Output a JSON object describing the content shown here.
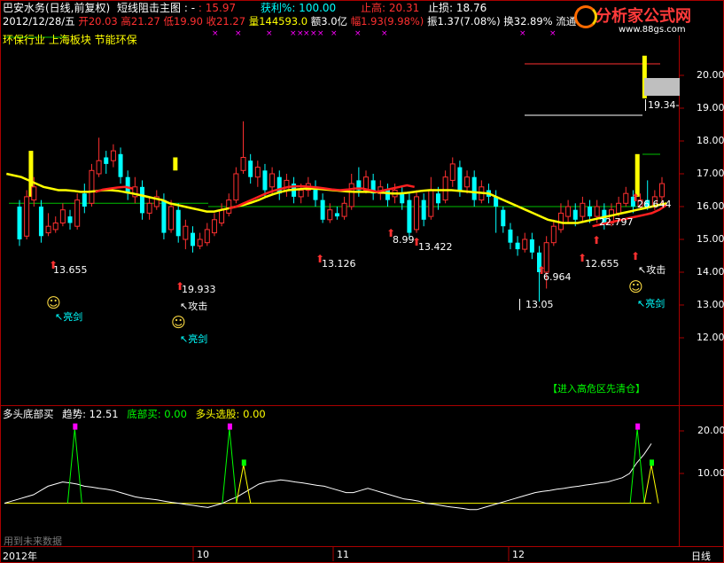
{
  "header": {
    "stock_title": "巴安水务(日线,前复权)",
    "indicator_name": "短线阻击主图",
    "indicator_sep": ": -",
    "indicator_value": ": 15.97",
    "profit_label": "获利%: 100.00",
    "stop_high": "止高: 20.31",
    "stop_loss": "止损: 18.76",
    "date_line": "2012/12/28/五",
    "open": "开20.03",
    "high": "高21.27",
    "low": "低19.90",
    "close": "收21.27",
    "volume": "量144593.0",
    "amount": "额3.0亿",
    "range": "幅1.93(9.98%)",
    "amplitude": "振1.37(7.08%)",
    "turnover": "换32.89%",
    "float_label": "流通",
    "industry": "环保行业 上海板块 节能环保"
  },
  "logo": {
    "name": "分析家公式网",
    "url": "www.88gs.com"
  },
  "price_axis": {
    "ticks": [
      "20.00",
      "19.00",
      "18.00",
      "17.00",
      "16.00",
      "15.00",
      "14.00",
      "13.00",
      "12.00"
    ],
    "current_marker": "19.34-"
  },
  "annotations": {
    "values": [
      "13.655",
      "19.933",
      "13.126",
      "8.99",
      "13.422",
      "6.964",
      "12.655",
      "22.797",
      "26.644",
      "13.05"
    ],
    "labels": {
      "liangjian": "亮剑",
      "gongji": "攻击"
    },
    "warning": "【进入高危区先清仓】"
  },
  "lower_panel": {
    "title": "多头底部买",
    "trend": "趋势: 12.51",
    "bottom_buy": "底部买: 0.00",
    "select": "多头选股: 0.00",
    "ticks": [
      "20.00",
      "10.00"
    ],
    "watermark": "用到未来数据"
  },
  "time_axis": {
    "labels": [
      "2012年",
      "10",
      "11",
      "12"
    ],
    "period": "日线"
  },
  "colors": {
    "up": "#ff3030",
    "down": "#00ffff",
    "ma_yellow": "#ffff00",
    "ma_red": "#ff2020",
    "grid_red": "#aa0000",
    "green_line": "#00c000",
    "magenta": "#ff00ff"
  },
  "chart_data": {
    "type": "candlestick",
    "y_range": [
      12.0,
      20.5
    ],
    "candles": [
      {
        "o": 16.0,
        "c": 15.0,
        "h": 16.2,
        "l": 14.8
      },
      {
        "o": 15.1,
        "c": 16.3,
        "h": 16.5,
        "l": 15.0
      },
      {
        "o": 16.2,
        "c": 16.6,
        "h": 16.9,
        "l": 16.0
      },
      {
        "o": 16.0,
        "c": 15.1,
        "h": 16.2,
        "l": 14.9
      },
      {
        "o": 15.2,
        "c": 15.4,
        "h": 15.8,
        "l": 15.1
      },
      {
        "o": 15.3,
        "c": 15.5,
        "h": 15.7,
        "l": 15.2
      },
      {
        "o": 15.5,
        "c": 15.9,
        "h": 16.1,
        "l": 15.4
      },
      {
        "o": 15.7,
        "c": 15.5,
        "h": 15.9,
        "l": 15.3
      },
      {
        "o": 15.4,
        "c": 16.2,
        "h": 16.4,
        "l": 15.3
      },
      {
        "o": 16.4,
        "c": 16.0,
        "h": 16.7,
        "l": 15.8
      },
      {
        "o": 16.1,
        "c": 17.1,
        "h": 17.3,
        "l": 16.0
      },
      {
        "o": 17.0,
        "c": 17.4,
        "h": 18.1,
        "l": 16.9
      },
      {
        "o": 17.5,
        "c": 17.3,
        "h": 17.7,
        "l": 17.0
      },
      {
        "o": 17.4,
        "c": 17.7,
        "h": 17.9,
        "l": 17.2
      },
      {
        "o": 17.6,
        "c": 16.9,
        "h": 17.8,
        "l": 16.7
      },
      {
        "o": 16.9,
        "c": 16.4,
        "h": 17.1,
        "l": 16.2
      },
      {
        "o": 16.3,
        "c": 16.6,
        "h": 16.9,
        "l": 16.1
      },
      {
        "o": 16.6,
        "c": 15.8,
        "h": 16.8,
        "l": 15.6
      },
      {
        "o": 15.8,
        "c": 16.1,
        "h": 16.3,
        "l": 15.6
      },
      {
        "o": 16.0,
        "c": 16.3,
        "h": 16.5,
        "l": 15.9
      },
      {
        "o": 16.2,
        "c": 15.2,
        "h": 16.4,
        "l": 15.0
      },
      {
        "o": 15.3,
        "c": 16.0,
        "h": 16.2,
        "l": 15.2
      },
      {
        "o": 15.9,
        "c": 15.1,
        "h": 16.1,
        "l": 14.9
      },
      {
        "o": 15.0,
        "c": 15.4,
        "h": 15.6,
        "l": 14.7
      },
      {
        "o": 15.2,
        "c": 14.8,
        "h": 15.4,
        "l": 14.6
      },
      {
        "o": 14.8,
        "c": 15.0,
        "h": 15.2,
        "l": 14.7
      },
      {
        "o": 14.9,
        "c": 15.3,
        "h": 15.5,
        "l": 14.8
      },
      {
        "o": 15.2,
        "c": 15.6,
        "h": 15.8,
        "l": 15.1
      },
      {
        "o": 15.5,
        "c": 15.9,
        "h": 16.1,
        "l": 15.4
      },
      {
        "o": 15.8,
        "c": 16.2,
        "h": 16.4,
        "l": 15.7
      },
      {
        "o": 16.2,
        "c": 17.0,
        "h": 17.2,
        "l": 16.1
      },
      {
        "o": 17.1,
        "c": 17.5,
        "h": 18.6,
        "l": 17.0
      },
      {
        "o": 17.4,
        "c": 16.9,
        "h": 17.6,
        "l": 16.7
      },
      {
        "o": 16.9,
        "c": 17.2,
        "h": 17.4,
        "l": 16.6
      },
      {
        "o": 17.1,
        "c": 16.5,
        "h": 17.3,
        "l": 16.3
      },
      {
        "o": 16.6,
        "c": 17.0,
        "h": 17.2,
        "l": 16.4
      },
      {
        "o": 16.9,
        "c": 16.4,
        "h": 17.1,
        "l": 16.2
      },
      {
        "o": 16.5,
        "c": 16.8,
        "h": 17.0,
        "l": 16.3
      },
      {
        "o": 16.7,
        "c": 16.3,
        "h": 16.9,
        "l": 16.1
      },
      {
        "o": 16.3,
        "c": 16.5,
        "h": 16.7,
        "l": 16.1
      },
      {
        "o": 16.5,
        "c": 16.7,
        "h": 16.9,
        "l": 16.3
      },
      {
        "o": 16.6,
        "c": 16.2,
        "h": 16.8,
        "l": 16.0
      },
      {
        "o": 16.2,
        "c": 15.6,
        "h": 16.4,
        "l": 15.5
      },
      {
        "o": 15.6,
        "c": 15.9,
        "h": 16.1,
        "l": 15.5
      },
      {
        "o": 15.8,
        "c": 15.7,
        "h": 16.0,
        "l": 15.6
      },
      {
        "o": 15.7,
        "c": 16.1,
        "h": 16.3,
        "l": 15.6
      },
      {
        "o": 16.0,
        "c": 16.7,
        "h": 17.0,
        "l": 15.9
      },
      {
        "o": 16.8,
        "c": 16.5,
        "h": 17.2,
        "l": 16.3
      },
      {
        "o": 16.5,
        "c": 16.9,
        "h": 17.1,
        "l": 16.4
      },
      {
        "o": 16.8,
        "c": 16.4,
        "h": 17.0,
        "l": 16.2
      },
      {
        "o": 16.4,
        "c": 16.6,
        "h": 16.8,
        "l": 16.2
      },
      {
        "o": 16.5,
        "c": 16.2,
        "h": 16.7,
        "l": 16.0
      },
      {
        "o": 16.3,
        "c": 16.5,
        "h": 16.7,
        "l": 16.1
      },
      {
        "o": 16.4,
        "c": 16.1,
        "h": 16.6,
        "l": 15.9
      },
      {
        "o": 16.2,
        "c": 15.2,
        "h": 16.4,
        "l": 15.0
      },
      {
        "o": 15.3,
        "c": 16.3,
        "h": 16.5,
        "l": 15.2
      },
      {
        "o": 16.2,
        "c": 15.6,
        "h": 16.4,
        "l": 15.4
      },
      {
        "o": 15.7,
        "c": 16.5,
        "h": 16.9,
        "l": 15.6
      },
      {
        "o": 16.4,
        "c": 16.1,
        "h": 16.6,
        "l": 15.9
      },
      {
        "o": 16.2,
        "c": 16.9,
        "h": 17.1,
        "l": 16.1
      },
      {
        "o": 16.8,
        "c": 17.3,
        "h": 17.5,
        "l": 16.6
      },
      {
        "o": 17.2,
        "c": 16.5,
        "h": 17.4,
        "l": 16.3
      },
      {
        "o": 16.6,
        "c": 16.9,
        "h": 17.1,
        "l": 16.4
      },
      {
        "o": 16.9,
        "c": 16.2,
        "h": 17.1,
        "l": 16.0
      },
      {
        "o": 16.2,
        "c": 16.6,
        "h": 16.8,
        "l": 16.1
      },
      {
        "o": 16.5,
        "c": 16.3,
        "h": 16.7,
        "l": 16.1
      },
      {
        "o": 16.3,
        "c": 16.0,
        "h": 16.5,
        "l": 15.2
      },
      {
        "o": 15.9,
        "c": 15.4,
        "h": 16.0,
        "l": 15.2
      },
      {
        "o": 15.3,
        "c": 14.9,
        "h": 15.5,
        "l": 14.7
      },
      {
        "o": 14.9,
        "c": 14.7,
        "h": 15.1,
        "l": 14.5
      },
      {
        "o": 14.7,
        "c": 15.0,
        "h": 15.2,
        "l": 14.6
      },
      {
        "o": 15.0,
        "c": 14.6,
        "h": 15.2,
        "l": 14.4
      },
      {
        "o": 14.6,
        "c": 14.0,
        "h": 14.8,
        "l": 13.1
      },
      {
        "o": 14.0,
        "c": 14.9,
        "h": 15.1,
        "l": 13.5
      },
      {
        "o": 14.9,
        "c": 15.4,
        "h": 15.6,
        "l": 14.8
      },
      {
        "o": 15.3,
        "c": 15.8,
        "h": 16.1,
        "l": 15.2
      },
      {
        "o": 15.7,
        "c": 16.0,
        "h": 16.2,
        "l": 15.5
      },
      {
        "o": 15.9,
        "c": 15.6,
        "h": 16.1,
        "l": 15.4
      },
      {
        "o": 15.7,
        "c": 16.1,
        "h": 16.3,
        "l": 15.5
      },
      {
        "o": 16.0,
        "c": 15.7,
        "h": 16.2,
        "l": 15.5
      },
      {
        "o": 15.7,
        "c": 16.0,
        "h": 16.2,
        "l": 15.5
      },
      {
        "o": 15.9,
        "c": 15.5,
        "h": 16.1,
        "l": 15.3
      },
      {
        "o": 15.5,
        "c": 15.9,
        "h": 16.1,
        "l": 15.4
      },
      {
        "o": 15.8,
        "c": 16.1,
        "h": 16.3,
        "l": 15.7
      },
      {
        "o": 16.1,
        "c": 16.4,
        "h": 16.6,
        "l": 16.0
      },
      {
        "o": 16.3,
        "c": 16.0,
        "h": 16.5,
        "l": 15.8
      },
      {
        "o": 16.0,
        "c": 16.2,
        "h": 16.4,
        "l": 15.9
      },
      {
        "o": 16.2,
        "c": 16.0,
        "h": 16.8,
        "l": 15.9
      },
      {
        "o": 16.0,
        "c": 16.3,
        "h": 16.5,
        "l": 15.9
      },
      {
        "o": 16.3,
        "c": 16.7,
        "h": 16.9,
        "l": 16.1
      }
    ],
    "ma_yellow": [
      17.0,
      16.95,
      16.9,
      16.8,
      16.7,
      16.6,
      16.55,
      16.5,
      16.5,
      16.48,
      16.45,
      16.45,
      16.47,
      16.5,
      16.5,
      16.48,
      16.44,
      16.4,
      16.35,
      16.3,
      16.25,
      16.2,
      16.1,
      16.05,
      16.0,
      15.95,
      15.9,
      15.85,
      15.85,
      15.9,
      15.95,
      16.0,
      16.05,
      16.12,
      16.2,
      16.3,
      16.38,
      16.45,
      16.5,
      16.52,
      16.54,
      16.55,
      16.54,
      16.52,
      16.5,
      16.48,
      16.46,
      16.45,
      16.45,
      16.45,
      16.44,
      16.42,
      16.4,
      16.4,
      16.42,
      16.45,
      16.48,
      16.5,
      16.5,
      16.5,
      16.5,
      16.48,
      16.46,
      16.44,
      16.42,
      16.4,
      16.3,
      16.2,
      16.1,
      16.0,
      15.9,
      15.8,
      15.7,
      15.6,
      15.55,
      15.5,
      15.5,
      15.5,
      15.55,
      15.6,
      15.65,
      15.7,
      15.75,
      15.8,
      15.85,
      15.9,
      15.95,
      16.0,
      16.05,
      16.1
    ],
    "ma_red": [
      null,
      null,
      null,
      null,
      null,
      null,
      null,
      null,
      null,
      null,
      null,
      null,
      16.45,
      16.52,
      16.55,
      16.58,
      16.6,
      16.55,
      null,
      null,
      null,
      null,
      null,
      null,
      null,
      null,
      null,
      null,
      null,
      null,
      15.95,
      16.0,
      16.1,
      16.2,
      16.3,
      16.4,
      16.48,
      16.54,
      16.6,
      16.62,
      16.62,
      16.6,
      16.58,
      16.55,
      16.52,
      16.5,
      16.52,
      16.55,
      16.55,
      16.5,
      16.45,
      16.5,
      16.55,
      16.6,
      16.65,
      16.6,
      null,
      null,
      null,
      null,
      null,
      null,
      null,
      null,
      null,
      null,
      null,
      null,
      null,
      null,
      null,
      null,
      null,
      null,
      null,
      null,
      null,
      null,
      null,
      15.4,
      15.45,
      15.5,
      15.55,
      15.6,
      15.65,
      15.7,
      15.75,
      15.8,
      15.9,
      16.05
    ],
    "ref_line_green": 16.0,
    "ref_line_green2": 16.1,
    "lower": {
      "y_range": [
        0,
        25
      ],
      "trend": [
        3,
        3.5,
        4,
        4.5,
        5,
        6,
        7,
        7.5,
        8,
        7.8,
        7.5,
        7,
        6.8,
        6.5,
        6.3,
        6,
        5.5,
        5,
        4.5,
        4.2,
        4,
        3.8,
        3.5,
        3.2,
        3,
        2.7,
        2.5,
        2.2,
        2,
        2.5,
        3,
        3.8,
        4.5,
        5.5,
        6.5,
        7.5,
        8,
        8.2,
        8.5,
        8.3,
        8,
        7.8,
        7.5,
        7.2,
        7,
        6.5,
        6,
        5.5,
        5.5,
        6,
        6.5,
        6,
        5.5,
        5,
        4.5,
        4,
        3.8,
        3.5,
        3,
        2.8,
        2.5,
        2.2,
        2,
        1.8,
        1.5,
        1.5,
        2,
        2.5,
        3,
        3.5,
        4,
        4.5,
        5,
        5.5,
        5.8,
        6,
        6.3,
        6.5,
        6.8,
        7,
        7.3,
        7.5,
        7.8,
        8,
        8.5,
        9,
        10,
        12.5,
        14.5,
        17
      ],
      "spikes_magenta": [
        10,
        32,
        90
      ],
      "spikes_green": [
        34,
        92
      ],
      "baseline": 3
    }
  }
}
